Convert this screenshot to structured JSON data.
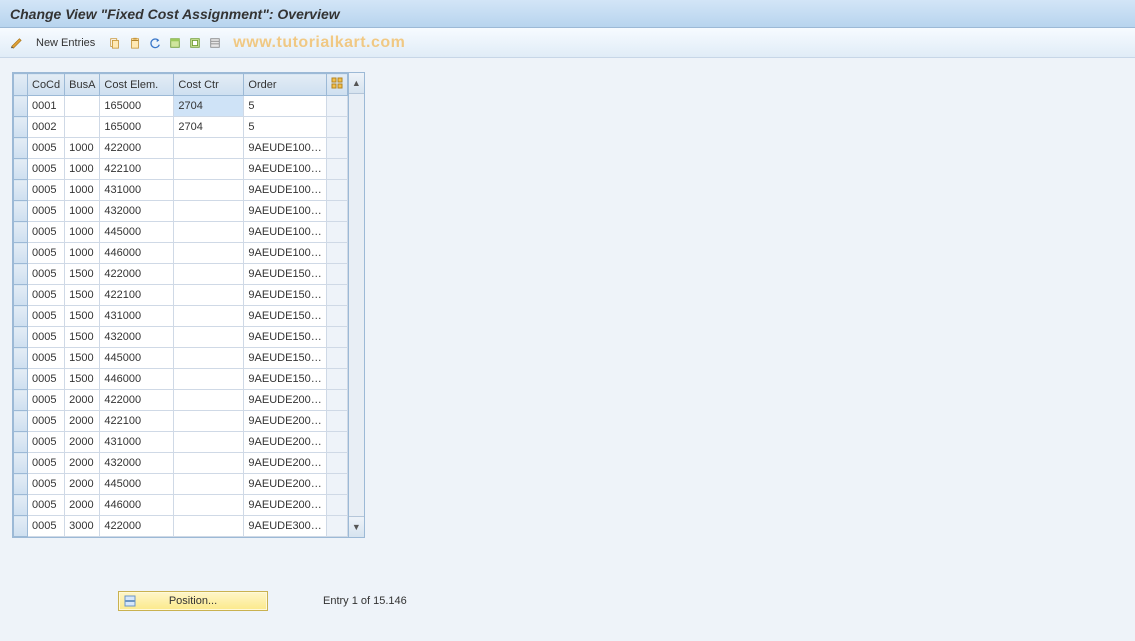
{
  "title": "Change View \"Fixed Cost Assignment\": Overview",
  "toolbar": {
    "new_entries_label": "New Entries",
    "watermark": "www.tutorialkart.com"
  },
  "table": {
    "headers": {
      "cocd": "CoCd",
      "busa": "BusA",
      "costelem": "Cost Elem.",
      "costctr": "Cost Ctr",
      "order": "Order"
    },
    "rows": [
      {
        "cocd": "0001",
        "busa": "",
        "costelem": "165000",
        "costctr": "2704",
        "order": "5",
        "highlight_ctr": true
      },
      {
        "cocd": "0002",
        "busa": "",
        "costelem": "165000",
        "costctr": "2704",
        "order": "5"
      },
      {
        "cocd": "0005",
        "busa": "1000",
        "costelem": "422000",
        "costctr": "",
        "order": "9AEUDE100…"
      },
      {
        "cocd": "0005",
        "busa": "1000",
        "costelem": "422100",
        "costctr": "",
        "order": "9AEUDE100…"
      },
      {
        "cocd": "0005",
        "busa": "1000",
        "costelem": "431000",
        "costctr": "",
        "order": "9AEUDE100…"
      },
      {
        "cocd": "0005",
        "busa": "1000",
        "costelem": "432000",
        "costctr": "",
        "order": "9AEUDE100…"
      },
      {
        "cocd": "0005",
        "busa": "1000",
        "costelem": "445000",
        "costctr": "",
        "order": "9AEUDE100…"
      },
      {
        "cocd": "0005",
        "busa": "1000",
        "costelem": "446000",
        "costctr": "",
        "order": "9AEUDE100…"
      },
      {
        "cocd": "0005",
        "busa": "1500",
        "costelem": "422000",
        "costctr": "",
        "order": "9AEUDE150…"
      },
      {
        "cocd": "0005",
        "busa": "1500",
        "costelem": "422100",
        "costctr": "",
        "order": "9AEUDE150…"
      },
      {
        "cocd": "0005",
        "busa": "1500",
        "costelem": "431000",
        "costctr": "",
        "order": "9AEUDE150…"
      },
      {
        "cocd": "0005",
        "busa": "1500",
        "costelem": "432000",
        "costctr": "",
        "order": "9AEUDE150…"
      },
      {
        "cocd": "0005",
        "busa": "1500",
        "costelem": "445000",
        "costctr": "",
        "order": "9AEUDE150…"
      },
      {
        "cocd": "0005",
        "busa": "1500",
        "costelem": "446000",
        "costctr": "",
        "order": "9AEUDE150…"
      },
      {
        "cocd": "0005",
        "busa": "2000",
        "costelem": "422000",
        "costctr": "",
        "order": "9AEUDE200…"
      },
      {
        "cocd": "0005",
        "busa": "2000",
        "costelem": "422100",
        "costctr": "",
        "order": "9AEUDE200…"
      },
      {
        "cocd": "0005",
        "busa": "2000",
        "costelem": "431000",
        "costctr": "",
        "order": "9AEUDE200…"
      },
      {
        "cocd": "0005",
        "busa": "2000",
        "costelem": "432000",
        "costctr": "",
        "order": "9AEUDE200…"
      },
      {
        "cocd": "0005",
        "busa": "2000",
        "costelem": "445000",
        "costctr": "",
        "order": "9AEUDE200…"
      },
      {
        "cocd": "0005",
        "busa": "2000",
        "costelem": "446000",
        "costctr": "",
        "order": "9AEUDE200…"
      },
      {
        "cocd": "0005",
        "busa": "3000",
        "costelem": "422000",
        "costctr": "",
        "order": "9AEUDE300…"
      }
    ]
  },
  "footer": {
    "position_label": "Position...",
    "entry_text": "Entry 1 of 15.146"
  }
}
